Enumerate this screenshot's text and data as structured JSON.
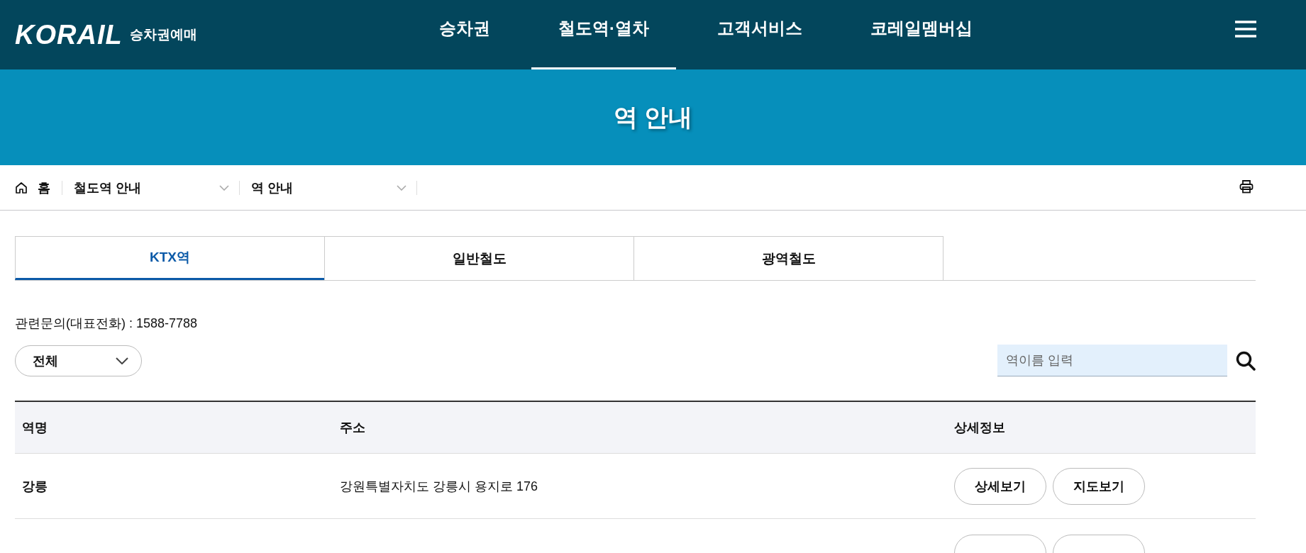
{
  "header": {
    "logo": "KORAIL",
    "logo_subtitle": "승차권예매",
    "nav": [
      {
        "label": "승차권",
        "selected": false
      },
      {
        "label": "철도역·열차",
        "selected": true
      },
      {
        "label": "고객서비스",
        "selected": false
      },
      {
        "label": "코레일멤버십",
        "selected": false
      }
    ]
  },
  "banner": {
    "title": "역 안내"
  },
  "breadcrumb": {
    "home": "홈",
    "levels": [
      "철도역 안내",
      "역 안내"
    ]
  },
  "tabs": [
    {
      "label": "KTX역",
      "selected": true
    },
    {
      "label": "일반철도",
      "selected": false
    },
    {
      "label": "광역철도",
      "selected": false
    }
  ],
  "inquiry": "관련문의(대표전화) : 1588-7788",
  "filter": {
    "value": "전체"
  },
  "search": {
    "placeholder": "역이름 입력"
  },
  "table": {
    "columns": [
      "역명",
      "주소",
      "상세정보"
    ],
    "rows": [
      {
        "name": "강릉",
        "address": "강원특별자치도 강릉시 용지로 176",
        "buttons": [
          "상세보기",
          "지도보기"
        ]
      }
    ]
  }
}
